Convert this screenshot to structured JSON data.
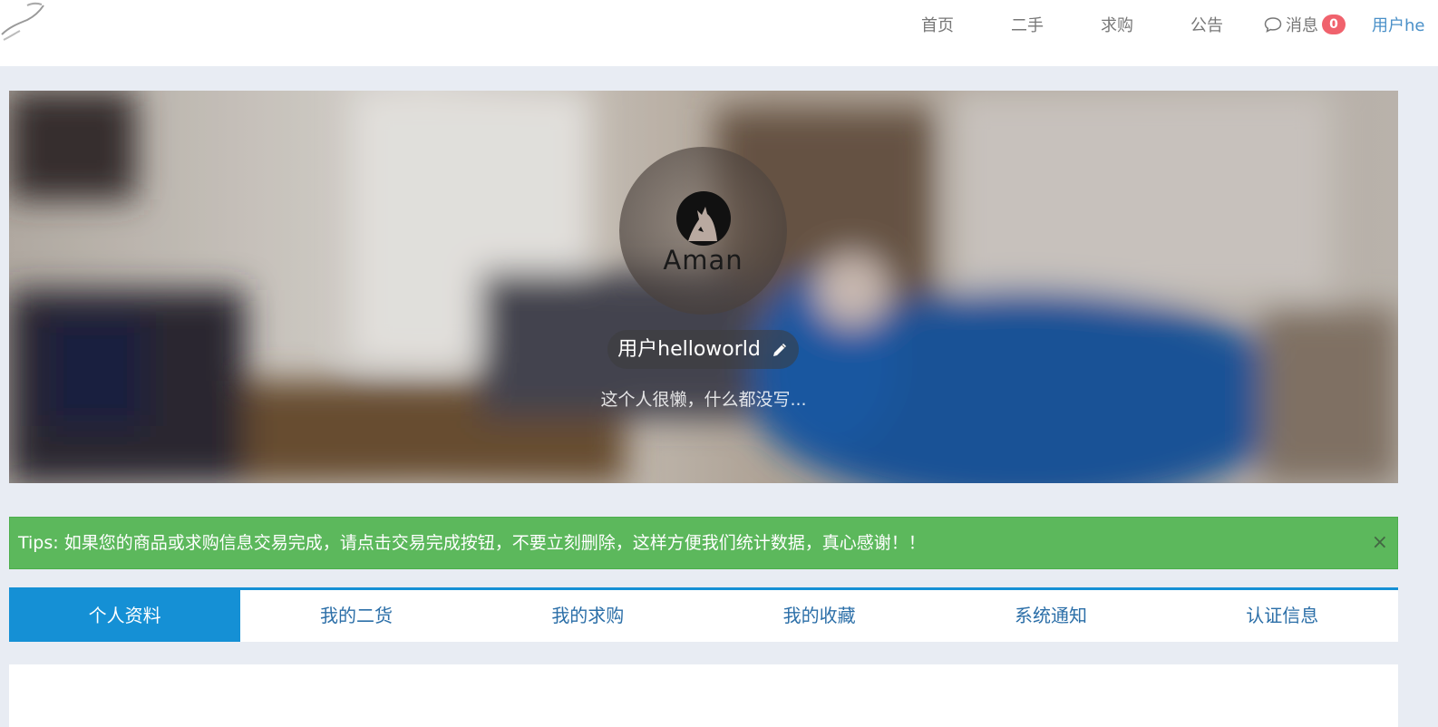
{
  "nav": {
    "home": "首页",
    "secondhand": "二手",
    "wanted": "求购",
    "notice": "公告",
    "messages": "消息",
    "message_count": "0",
    "user": "用户he"
  },
  "profile": {
    "avatar_text": "Aman",
    "username": "用户helloworld",
    "bio": "这个人很懒，什么都没写..."
  },
  "tips": {
    "text": "Tips: 如果您的商品或求购信息交易完成，请点击交易完成按钮，不要立刻删除，这样方便我们统计数据，真心感谢！！",
    "close": "×"
  },
  "tabs": [
    {
      "label": "个人资料"
    },
    {
      "label": "我的二货"
    },
    {
      "label": "我的求购"
    },
    {
      "label": "我的收藏"
    },
    {
      "label": "系统通知"
    },
    {
      "label": "认证信息"
    }
  ],
  "active_tab": 0,
  "colors": {
    "accent": "#1590d5",
    "success": "#5cb85c",
    "badge": "#f0626d"
  }
}
